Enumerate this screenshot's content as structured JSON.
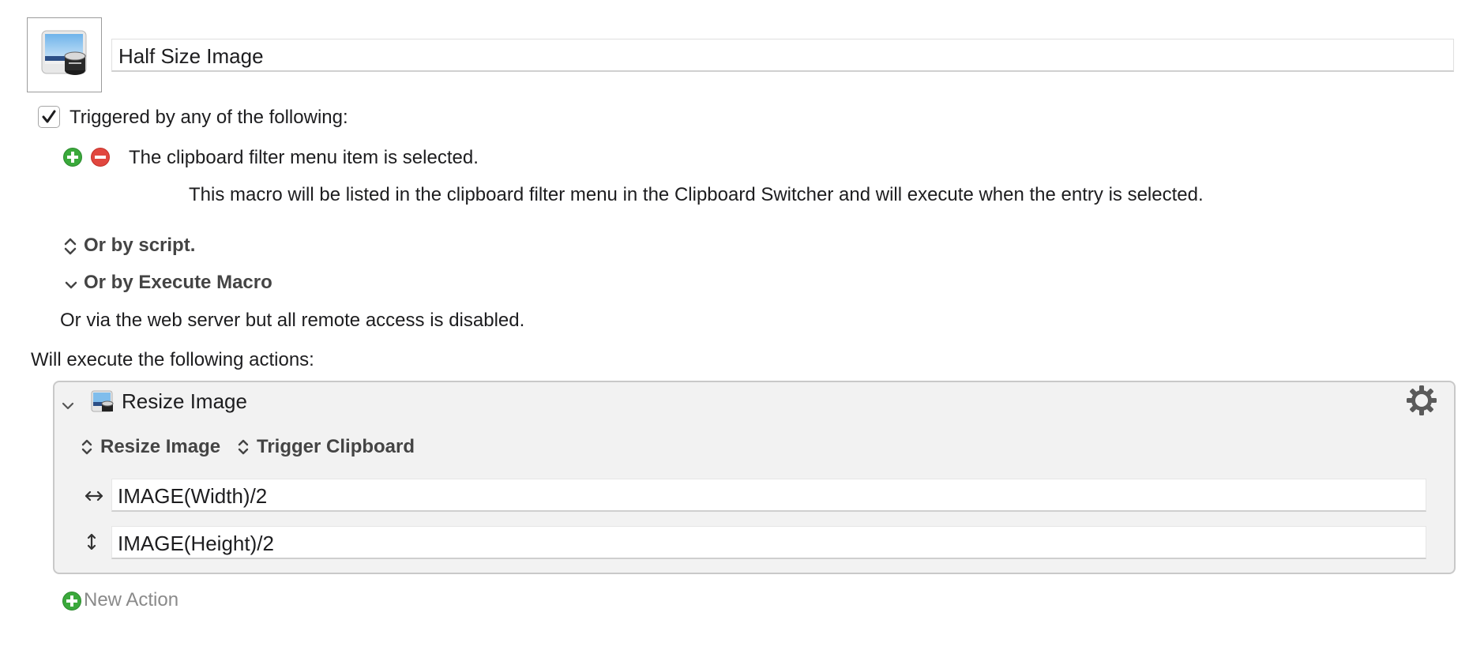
{
  "macro": {
    "name": "Half Size Image",
    "icon": "preview-app-icon"
  },
  "trigger": {
    "checkbox_checked": true,
    "heading": "Triggered by any of the following:",
    "items": [
      {
        "title": "The clipboard filter menu item is selected.",
        "description": "This macro will be listed in the clipboard filter menu in the Clipboard Switcher and will execute when the entry is selected."
      }
    ],
    "or_by_script": "Or by script.",
    "or_by_execute_macro": "Or by Execute Macro",
    "web_server_note": "Or via the web server but all remote access is disabled."
  },
  "actions": {
    "heading": "Will execute the following actions:",
    "list": [
      {
        "title": "Resize Image",
        "mode_popup": "Resize Image",
        "target_popup": "Trigger Clipboard",
        "width_value": "IMAGE(Width)/2",
        "height_value": "IMAGE(Height)/2"
      }
    ],
    "new_action_label": "New Action"
  },
  "colors": {
    "add": "#3aa93b",
    "remove": "#e1473f",
    "action_bg": "#f2f2f2"
  }
}
